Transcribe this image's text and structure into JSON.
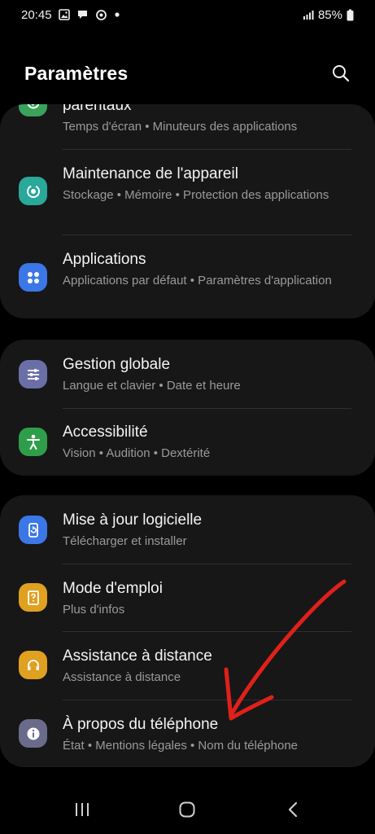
{
  "status_bar": {
    "time": "20:45",
    "battery": "85%",
    "icons": [
      "gallery-icon",
      "chat-icon",
      "sync-icon",
      "dot-icon",
      "signal-icon",
      "battery-icon"
    ]
  },
  "header": {
    "title": "Paramètres",
    "search_icon": "search-icon"
  },
  "groups": [
    {
      "items": [
        {
          "title": "parentaux",
          "subtitle": "Temps d'écran • Minuteurs des applications",
          "icon": "parental-control-icon",
          "color": "#3aa25b"
        },
        {
          "title": "Maintenance de l'appareil",
          "subtitle": "Stockage • Mémoire • Protection des applications",
          "icon": "device-care-icon",
          "color": "#2aa89a"
        },
        {
          "title": "Applications",
          "subtitle": "Applications par défaut • Paramètres d'application",
          "icon": "apps-grid-icon",
          "color": "#3b77e6"
        }
      ]
    },
    {
      "items": [
        {
          "title": "Gestion globale",
          "subtitle": "Langue et clavier • Date et heure",
          "icon": "sliders-icon",
          "color": "#6b6fa8"
        },
        {
          "title": "Accessibilité",
          "subtitle": "Vision • Audition • Dextérité",
          "icon": "accessibility-icon",
          "color": "#2f9e4a"
        }
      ]
    },
    {
      "items": [
        {
          "title": "Mise à jour logicielle",
          "subtitle": "Télécharger et installer",
          "icon": "software-update-icon",
          "color": "#3b77e6"
        },
        {
          "title": "Mode d'emploi",
          "subtitle": "Plus d'infos",
          "icon": "user-manual-icon",
          "color": "#e0a020"
        },
        {
          "title": "Assistance à distance",
          "subtitle": "Assistance à distance",
          "icon": "headset-icon",
          "color": "#e0a020"
        },
        {
          "title": "À propos du téléphone",
          "subtitle": "État • Mentions légales • Nom du téléphone",
          "icon": "info-icon",
          "color": "#6a6a8a"
        }
      ]
    }
  ],
  "nav_bar": {
    "recents_icon": "recents-icon",
    "home_icon": "home-icon",
    "back_icon": "back-icon"
  },
  "colors": {
    "background": "#000000",
    "card": "#171717",
    "annotation_arrow": "#e0201a"
  }
}
